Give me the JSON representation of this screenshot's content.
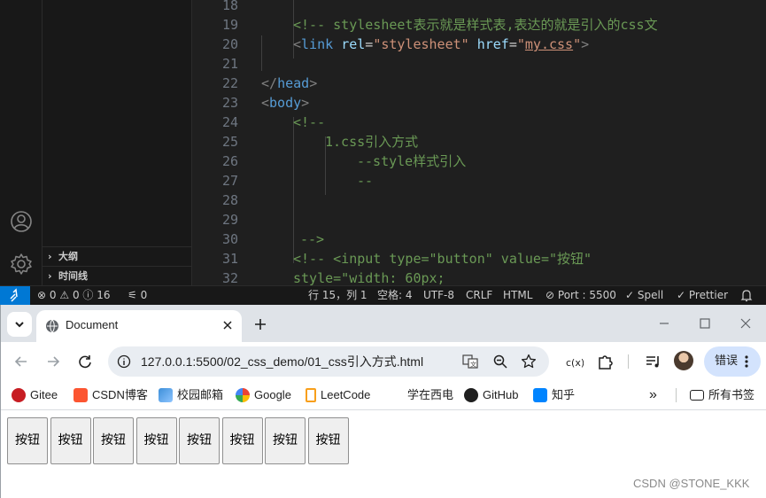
{
  "vscode": {
    "sidebar": {
      "outline_label": "大纲",
      "timeline_label": "时间线"
    },
    "editor": {
      "lines": [
        {
          "n": "18",
          "segs": []
        },
        {
          "n": "19",
          "segs": [
            {
              "t": "<!-- stylesheet表示就是样式表,表达的就是引入的css文",
              "c": "com"
            }
          ]
        },
        {
          "n": "20",
          "segs": [
            {
              "t": "<",
              "c": "pun"
            },
            {
              "t": "link",
              "c": "tag"
            },
            {
              "t": " ",
              "c": ""
            },
            {
              "t": "rel",
              "c": "att"
            },
            {
              "t": "=",
              "c": ""
            },
            {
              "t": "\"stylesheet\"",
              "c": "str"
            },
            {
              "t": " ",
              "c": ""
            },
            {
              "t": "href",
              "c": "att"
            },
            {
              "t": "=",
              "c": ""
            },
            {
              "t": "\"",
              "c": "str"
            },
            {
              "t": "my.css",
              "c": "str u"
            },
            {
              "t": "\"",
              "c": "str"
            },
            {
              "t": ">",
              "c": "pun"
            }
          ]
        },
        {
          "n": "21",
          "segs": []
        },
        {
          "n": "22",
          "segs": [
            {
              "t": "</",
              "c": "pun"
            },
            {
              "t": "head",
              "c": "tag"
            },
            {
              "t": ">",
              "c": "pun"
            }
          ]
        },
        {
          "n": "23",
          "segs": [
            {
              "t": "<",
              "c": "pun"
            },
            {
              "t": "body",
              "c": "tag"
            },
            {
              "t": ">",
              "c": "pun"
            }
          ]
        },
        {
          "n": "24",
          "segs": [
            {
              "t": "<!--",
              "c": "com"
            }
          ]
        },
        {
          "n": "25",
          "segs": [
            {
              "t": "1.css引入方式",
              "c": "com"
            }
          ]
        },
        {
          "n": "26",
          "segs": [
            {
              "t": "--style样式引入",
              "c": "com"
            }
          ]
        },
        {
          "n": "27",
          "segs": [
            {
              "t": "--",
              "c": "com"
            }
          ]
        },
        {
          "n": "28",
          "segs": []
        },
        {
          "n": "29",
          "segs": []
        },
        {
          "n": "30",
          "segs": [
            {
              "t": "-->",
              "c": "com"
            }
          ]
        },
        {
          "n": "31",
          "segs": [
            {
              "t": "<!-- <input type=\"button\" value=\"按钮\"",
              "c": "com"
            }
          ]
        },
        {
          "n": "32",
          "segs": [
            {
              "t": "style=\"width: 60px;",
              "c": "com"
            }
          ]
        }
      ]
    },
    "statusbar": {
      "problems": "0",
      "warnings": "0",
      "info": "16",
      "ports": "0",
      "cursor": "行 15，列 1",
      "spaces": "空格: 4",
      "encoding": "UTF-8",
      "eol": "CRLF",
      "language": "HTML",
      "port": "Port : 5500",
      "spell": "Spell",
      "prettier": "Prettier"
    }
  },
  "browser": {
    "tab_title": "Document",
    "url": "127.0.0.1:5500/02_css_demo/01_css引入方式.html",
    "error_label": "错误",
    "bookmarks": [
      "Gitee",
      "CSDN博客",
      "校园邮箱",
      "Google",
      "LeetCode",
      "学在西电",
      "GitHub",
      "知乎"
    ],
    "all_bookmarks": "所有书签",
    "page_buttons": [
      "按钮",
      "按钮",
      "按钮",
      "按钮",
      "按钮",
      "按钮",
      "按钮",
      "按钮"
    ],
    "watermark": "CSDN @STONE_KKK"
  },
  "colors": {
    "vscode_bg": "#1f1f1f",
    "remote_blue": "#0078d4",
    "comment": "#6a9955",
    "tag": "#569cd6",
    "attr": "#9cdcfe",
    "string": "#ce9178"
  }
}
